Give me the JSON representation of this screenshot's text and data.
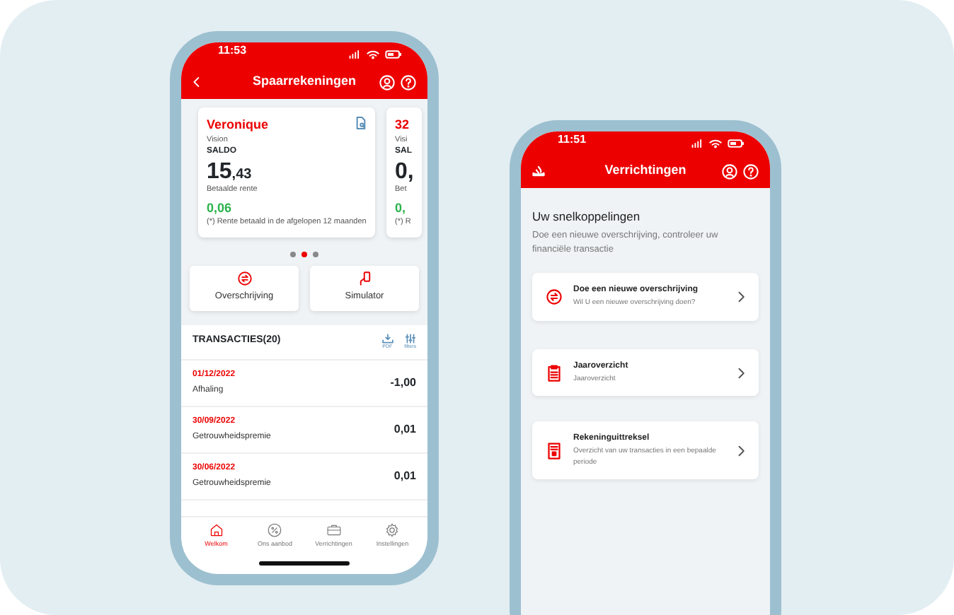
{
  "phones": [
    {
      "kind": "accounts",
      "status_time": "11:53",
      "title": "Spaarrekeningen",
      "accounts": [
        {
          "name": "Veronique",
          "product": "Vision",
          "balance_label": "SALDO",
          "balance_main": "15",
          "balance_cents": ",43",
          "interest_label": "Betaalde rente",
          "interest": "0,06",
          "footnote": "(*) Rente betaald in de afgelopen 12 maanden"
        },
        {
          "name": "32",
          "product": "Visi",
          "balance_label": "SAL",
          "balance_main": "0,",
          "interest_label": "Bet",
          "interest": "0,",
          "footnote": "(*) R"
        }
      ],
      "pager": [
        {
          "selected": false
        },
        {
          "selected": true
        },
        {
          "selected": false
        }
      ],
      "actions": [
        {
          "kind": "transfer",
          "label": "Overschrijving"
        },
        {
          "kind": "simulator",
          "label": "Simulator"
        }
      ],
      "transactions_title": "TRANSACTIES(20)",
      "tools": [
        {
          "kind": "download",
          "label": "PDF"
        },
        {
          "kind": "filter",
          "label": "filters"
        }
      ],
      "transactions": [
        {
          "date": "01/12/2022",
          "description": "Afhaling",
          "amount": "-1,00"
        },
        {
          "date": "30/09/2022",
          "description": "Getrouwheidspremie",
          "amount": "0,01"
        },
        {
          "date": "30/06/2022",
          "description": "Getrouwheidspremie",
          "amount": "0,01"
        }
      ],
      "nav": [
        {
          "kind": "home",
          "label": "Welkom",
          "selected": true
        },
        {
          "kind": "percent",
          "label": "Ons aanbod",
          "selected": false
        },
        {
          "kind": "briefcase",
          "label": "Verrichtingen",
          "selected": false
        },
        {
          "kind": "gear",
          "label": "Instellingen",
          "selected": false
        }
      ]
    },
    {
      "kind": "shortcuts",
      "status_time": "11:51",
      "title": "Verrichtingen",
      "section_title": "Uw snelkoppelingen",
      "section_subtitle": "Doe een nieuwe overschrijving, controleer uw financiële transactie",
      "shortcuts": [
        {
          "kind": "transfer",
          "title": "Doe een nieuwe overschrijving",
          "subtitle": "Wil U een nieuwe overschrijving doen?"
        },
        {
          "kind": "clipboard",
          "title": "Jaaroverzicht",
          "subtitle": "Jaaroverzicht"
        },
        {
          "kind": "document",
          "title": "Rekeninguittreksel",
          "subtitle": "Overzicht van uw transacties in een bepaalde periode"
        }
      ]
    }
  ]
}
